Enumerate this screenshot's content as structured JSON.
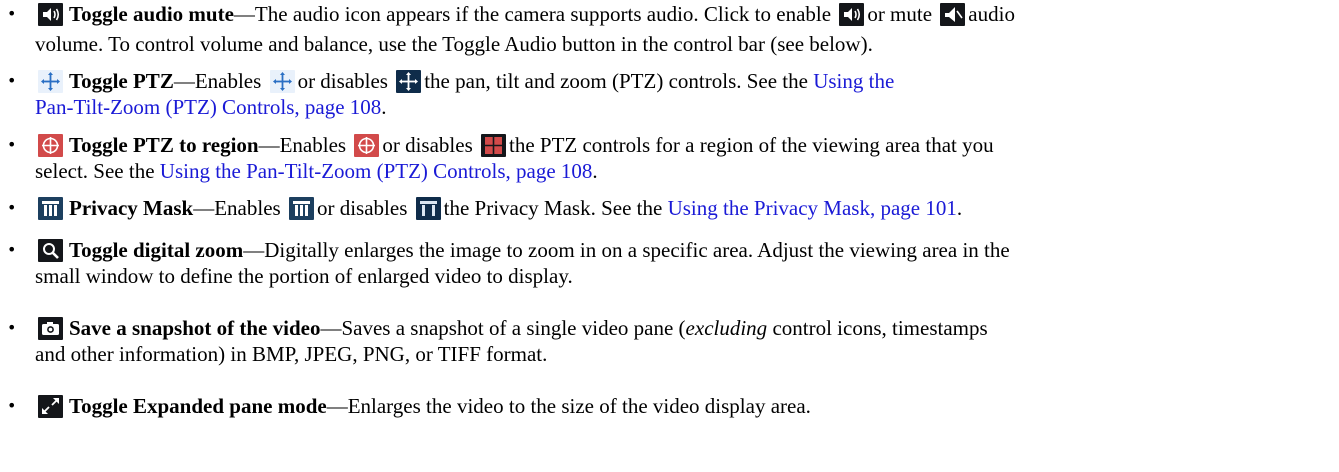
{
  "items": [
    {
      "term": "Toggle audio mute",
      "line1": {
        "a": "—The audio icon appears if the camera supports audio. Click to enable",
        "b": "or mute",
        "c": "audio"
      },
      "line2": "volume. To control volume and balance, use the Toggle Audio button in the control bar (see below).",
      "icons": [
        "speaker-on-icon",
        "speaker-on-icon",
        "speaker-mute-icon"
      ]
    },
    {
      "term": "Toggle PTZ",
      "line1": {
        "a": "—Enables",
        "b": "or disables",
        "c": "the pan, tilt and zoom (PTZ) controls. See the",
        "link": "Using the"
      },
      "line2_link": "Pan-Tilt-Zoom (PTZ) Controls, page 108",
      "line2_tail": ".",
      "icons": [
        "ptz-move-icon",
        "ptz-move-icon",
        "ptz-move-icon"
      ]
    },
    {
      "term": "Toggle PTZ to region",
      "line1": {
        "a": "—Enables",
        "b": "or disables",
        "c": "the PTZ controls for a region of the viewing area that you"
      },
      "line2_text": "select. See the",
      "line2_link": "Using the Pan-Tilt-Zoom (PTZ) Controls, page  108",
      "line2_tail": ".",
      "icons": [
        "ptz-region-icon",
        "ptz-region-icon",
        "ptz-region-icon"
      ]
    },
    {
      "term": "Privacy Mask",
      "line1": {
        "a": "—Enables",
        "b": "or disables",
        "c": "the Privacy Mask. See the",
        "link": "Using the Privacy Mask, page 101",
        "tail": "."
      },
      "icons": [
        "privacy-mask-icon",
        "privacy-mask-icon",
        "privacy-mask-icon"
      ]
    },
    {
      "term": "Toggle digital zoom",
      "line1": {
        "a": "—Digitally enlarges the image to zoom in on a specific area. Adjust the viewing area in the"
      },
      "line2": "small window to define the portion of enlarged video to display.",
      "icons": [
        "magnifier-icon"
      ]
    },
    {
      "term": "Save a snapshot of the video",
      "line1": {
        "a": "—Saves a snapshot of a single video pane (",
        "em": "excluding",
        "c": " control icons, timestamps"
      },
      "line2": "and other information) in BMP, JPEG, PNG, or TIFF format.",
      "icons": [
        "camera-icon"
      ]
    },
    {
      "term": "Toggle Expanded pane mode",
      "line1": {
        "a": "—Enlarges the video to the size of the video display area."
      },
      "icons": [
        "expand-icon"
      ]
    }
  ],
  "bullet_char": "•"
}
